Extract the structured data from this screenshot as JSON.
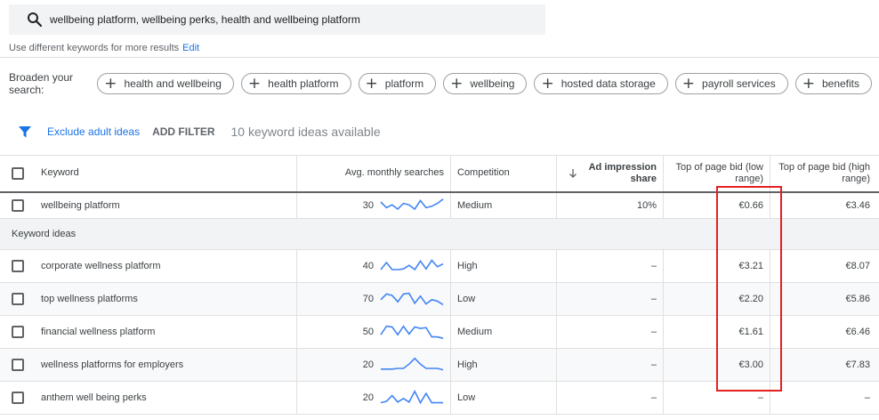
{
  "search": {
    "query": "wellbeing platform, wellbeing perks, health and wellbeing platform",
    "hint": "Use different keywords for more results",
    "edit_label": "Edit"
  },
  "broaden": {
    "label": "Broaden your search:",
    "chips": [
      "health and wellbeing",
      "health platform",
      "platform",
      "wellbeing",
      "hosted data storage",
      "payroll services",
      "benefits"
    ]
  },
  "filters": {
    "exclude_label": "Exclude adult ideas",
    "add_filter_label": "ADD FILTER",
    "count_text": "10 keyword ideas available"
  },
  "table": {
    "headers": {
      "keyword": "Keyword",
      "searches": "Avg. monthly searches",
      "competition": "Competition",
      "impression_line1": "Ad impression",
      "impression_line2": "share",
      "bid_low_line1": "Top of page bid (low",
      "bid_low_line2": "range)",
      "bid_high_line1": "Top of page bid (high",
      "bid_high_line2": "range)"
    },
    "sort_icon": "arrow-down-icon",
    "section_label": "Keyword ideas",
    "provided": {
      "keyword": "wellbeing platform",
      "searches": "30",
      "competition": "Medium",
      "impression": "10%",
      "bid_low": "€0.66",
      "bid_high": "€3.46",
      "trend": [
        0.25,
        0.65,
        0.45,
        0.75,
        0.35,
        0.45,
        0.75,
        0.15,
        0.65,
        0.55,
        0.35,
        0.05
      ]
    },
    "rows": [
      {
        "keyword": "corporate wellness platform",
        "searches": "40",
        "competition": "High",
        "impression": "–",
        "bid_low": "€3.21",
        "bid_high": "€8.07",
        "trend": [
          0.75,
          0.25,
          0.75,
          0.75,
          0.7,
          0.45,
          0.75,
          0.15,
          0.7,
          0.1,
          0.55,
          0.35
        ]
      },
      {
        "keyword": "top wellness platforms",
        "searches": "70",
        "competition": "Low",
        "impression": "–",
        "bid_low": "€2.20",
        "bid_high": "€5.86",
        "trend": [
          0.55,
          0.15,
          0.25,
          0.7,
          0.15,
          0.1,
          0.8,
          0.3,
          0.85,
          0.55,
          0.65,
          0.9
        ]
      },
      {
        "keyword": "financial wellness platform",
        "searches": "50",
        "competition": "Medium",
        "impression": "–",
        "bid_low": "€1.61",
        "bid_high": "€6.46",
        "trend": [
          0.7,
          0.1,
          0.15,
          0.7,
          0.1,
          0.65,
          0.15,
          0.25,
          0.2,
          0.85,
          0.85,
          0.95
        ]
      },
      {
        "keyword": "wellness platforms for employers",
        "searches": "20",
        "competition": "High",
        "impression": "–",
        "bid_low": "€3.00",
        "bid_high": "€7.83",
        "trend": [
          0.8,
          0.8,
          0.8,
          0.75,
          0.75,
          0.45,
          0.05,
          0.45,
          0.75,
          0.75,
          0.75,
          0.85
        ]
      },
      {
        "keyword": "anthem well being perks",
        "searches": "20",
        "competition": "Low",
        "impression": "–",
        "bid_low": "–",
        "bid_high": "–",
        "trend": [
          0.85,
          0.75,
          0.35,
          0.8,
          0.55,
          0.8,
          0.05,
          0.85,
          0.2,
          0.85,
          0.85,
          0.85
        ]
      }
    ]
  },
  "colors": {
    "accent": "#1a73e8",
    "sparkline": "#4285f4",
    "highlight": "#e52020"
  }
}
